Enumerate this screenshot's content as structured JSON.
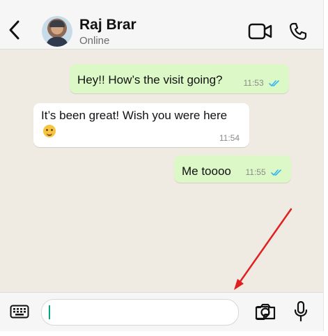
{
  "header": {
    "contact_name": "Raj Brar",
    "status": "Online",
    "icons": {
      "back": "chevron-left-icon",
      "video": "video-camera-icon",
      "call": "phone-icon"
    }
  },
  "messages": [
    {
      "direction": "outgoing",
      "text": "Hey!! How’s the visit going?",
      "time": "11:53",
      "read": true
    },
    {
      "direction": "incoming",
      "text": "It’s been great! Wish you were here",
      "emoji": "smiling-face-icon",
      "time": "11:54"
    },
    {
      "direction": "outgoing",
      "text": "Me toooo",
      "time": "11:55",
      "read": true
    }
  ],
  "input_bar": {
    "message_value": "",
    "icons": {
      "keyboard": "keyboard-icon",
      "sticker": "sticker-icon",
      "camera": "camera-icon",
      "mic": "microphone-icon"
    }
  },
  "annotation": {
    "icon": "red-arrow-icon"
  },
  "colors": {
    "outgoing_bubble": "#dcf8c6",
    "incoming_bubble": "#ffffff",
    "chat_background": "#efeae2",
    "read_ticks": "#34b7f1",
    "annotation_arrow": "#e02020"
  }
}
